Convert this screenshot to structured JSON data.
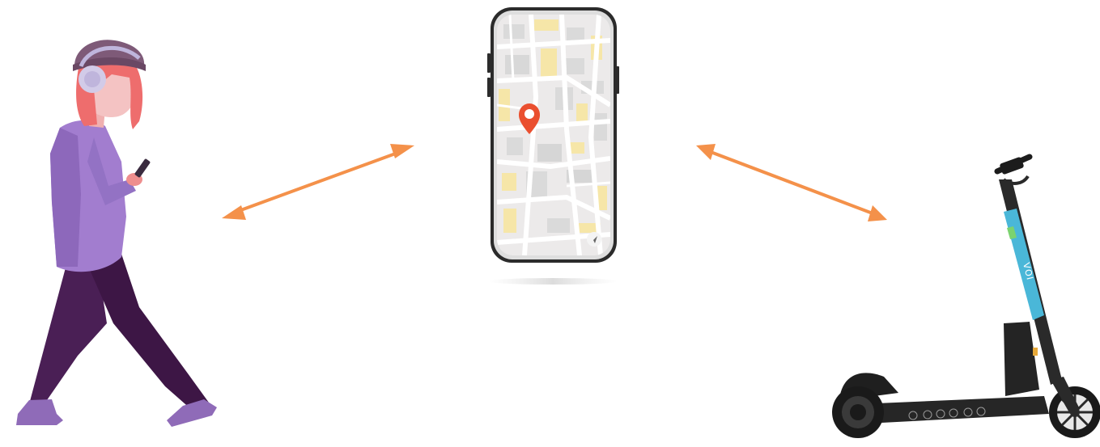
{
  "diagram": {
    "nodes": [
      {
        "id": "pedestrian",
        "icon": "walking-person-icon",
        "colors": {
          "hoodie": "#a27dcf",
          "pants": "#4a1f55",
          "hair": "#ee6d6d",
          "hat": "#7e5a78",
          "headphones": "#d2cbe8"
        }
      },
      {
        "id": "phone",
        "icon": "smartphone-map-icon",
        "colors": {
          "frame": "#2b2b2b",
          "map_bg": "#eceaea",
          "roads": "#ffffff",
          "blocks": "#f6e6a8",
          "pin": "#ea4f2f"
        }
      },
      {
        "id": "scooter",
        "icon": "electric-scooter-icon",
        "brand_text": "VOI",
        "colors": {
          "body": "#2a2a2a",
          "accent": "#4ab7d8"
        }
      }
    ],
    "edges": [
      {
        "from": "pedestrian",
        "to": "phone",
        "direction": "bidirectional"
      },
      {
        "from": "phone",
        "to": "scooter",
        "direction": "bidirectional"
      }
    ],
    "arrow_color": "#f4914a"
  }
}
